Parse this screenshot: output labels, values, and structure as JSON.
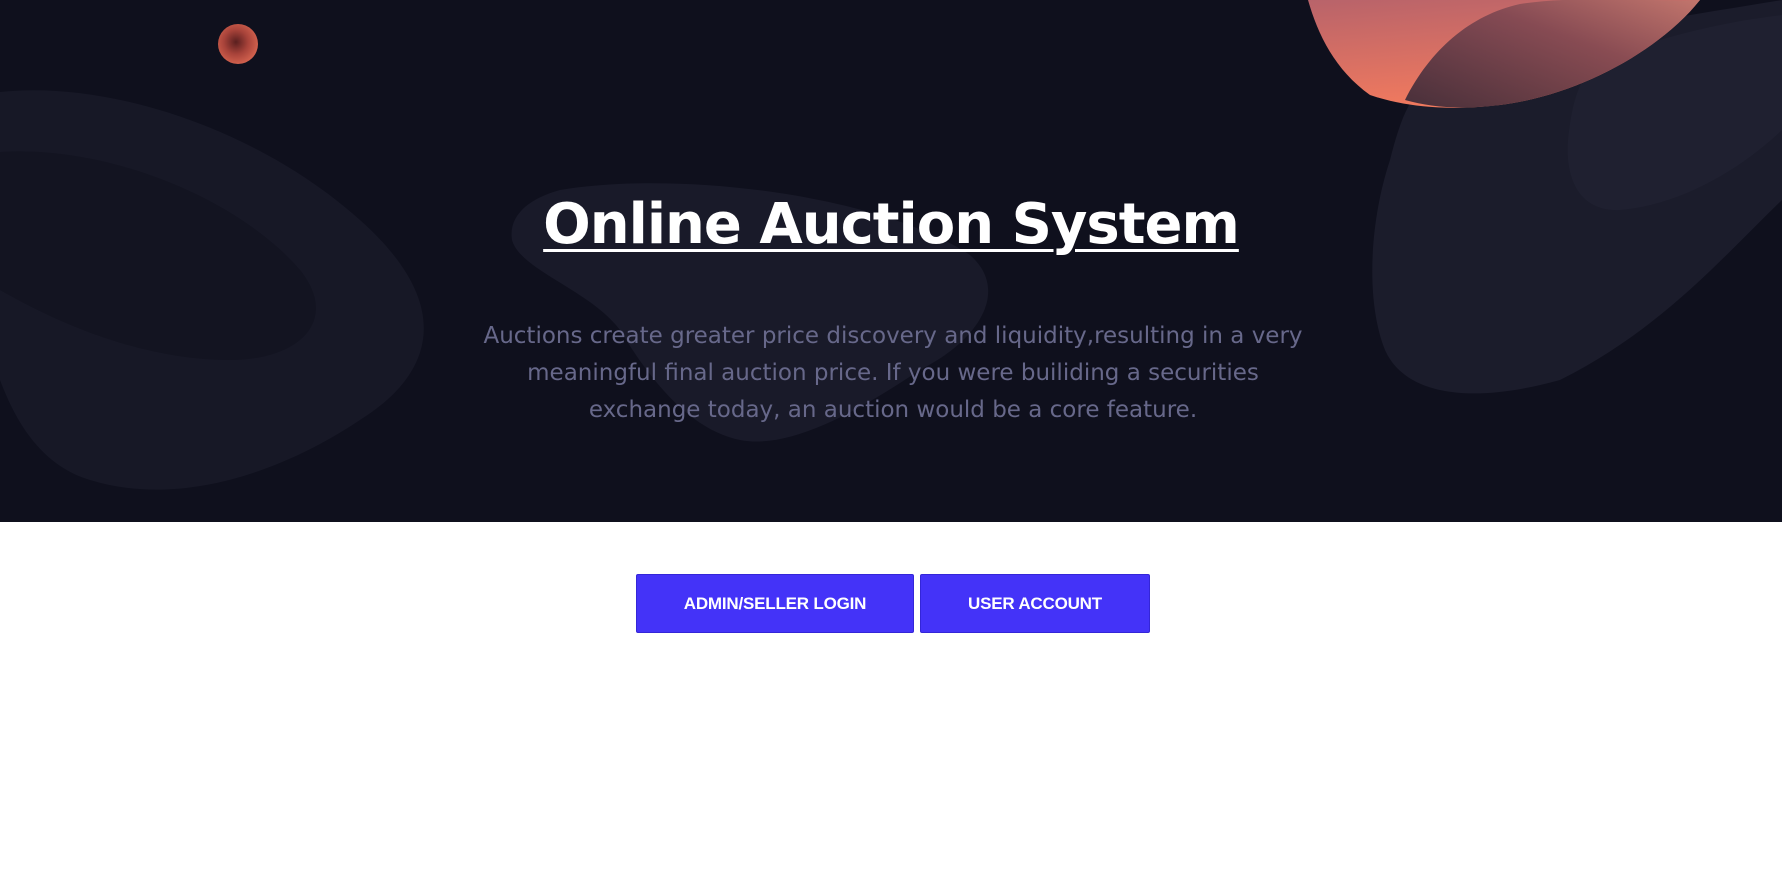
{
  "hero": {
    "title": "Online Auction System",
    "description": "Auctions create greater price discovery and liquidity,resulting in a very meaningful final auction price. If you were builiding a securities exchange today, an auction would be a core feature."
  },
  "actions": {
    "admin_label": "ADMIN/SELLER LOGIN",
    "user_label": "USER ACCOUNT"
  },
  "colors": {
    "hero_background": "#0f101d",
    "accent": "#4433f8",
    "description_text": "#67688a",
    "decoration_coral": "#f07b64"
  }
}
